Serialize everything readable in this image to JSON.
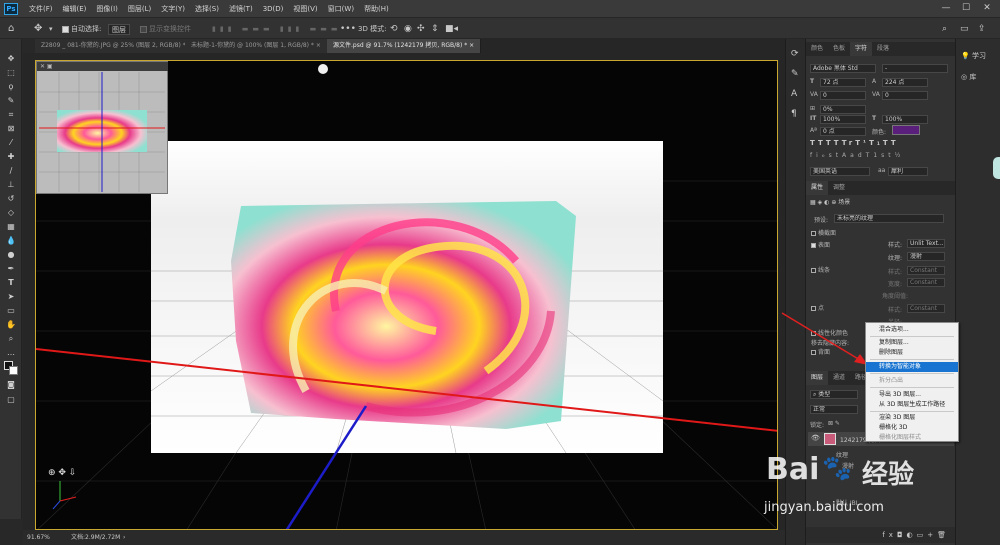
{
  "app": {
    "logo": "Ps"
  },
  "menu": [
    "文件(F)",
    "编辑(E)",
    "图像(I)",
    "图层(L)",
    "文字(Y)",
    "选择(S)",
    "滤镜(T)",
    "3D(D)",
    "视图(V)",
    "窗口(W)",
    "帮助(H)"
  ],
  "options_bar": {
    "auto_select_label": "自动选择:",
    "auto_select_value": "图层",
    "show_transform_label": "显示变换控件",
    "mode_3d_label": "3D 模式:"
  },
  "tabs": [
    "Z2809 _ 081-你黛的.JPG @ 25% (图层 2, RGB/8) *",
    "未标题-1-你黛的 @ 100% (图层 1, RGB/8) *",
    "源文件.psd @ 91.7% (1242179 拷贝, RGB/8) *"
  ],
  "status": {
    "zoom": "91.67%",
    "doc": "文档:2.9M/2.72M"
  },
  "character_panel": {
    "tabs": [
      "颜色",
      "色板",
      "字符",
      "段落"
    ],
    "font": "Adobe 黑体 Std",
    "style": "-",
    "size": "72 点",
    "leading": "224 点",
    "kerning": "0",
    "tracking": "0",
    "scale_pct": "0%",
    "vert_scale": "100%",
    "horiz_scale": "100%",
    "baseline": "0 点",
    "color_label": "颜色:",
    "typo_buttons": [
      "T",
      "T",
      "TT",
      "Tr",
      "T¹",
      "T₁",
      "T",
      "T"
    ],
    "extra_buttons": [
      "fi",
      "ℴ",
      "st",
      "A",
      "ad",
      "T",
      "1st",
      "½"
    ],
    "language": "美国英语",
    "aa_symbol": "aa",
    "antialias": "犀利"
  },
  "properties_panel": {
    "tabs": [
      "属性",
      "调整"
    ],
    "tab_scene": "场景",
    "preset_label": "预设:",
    "preset_value": "未标亮的纹理",
    "cross_section": "横截面",
    "surface": "表面",
    "style_label": "样式:",
    "style_value": "Unlit Text...",
    "texture_label": "纹理:",
    "texture_value": "漫射",
    "lines": "线条",
    "lines_style": "样式:",
    "lines_style_value": "Constant",
    "width_label": "宽度:",
    "width_value": "Constant",
    "angle_label": "角度阈值:",
    "points": "点",
    "points_style": "样式:",
    "points_style_value": "Constant",
    "radius_label": "半径:",
    "linearize": "线性化颜色",
    "remove_hidden": "移去隐藏内容:",
    "backface": "背面"
  },
  "layers_panel": {
    "tabs": [
      "图层",
      "通道",
      "路径"
    ],
    "kind": "类型",
    "blend": "正常",
    "lock_label": "锁定:",
    "layer_name": "1242179 拷贝",
    "texture_label": "纹理",
    "diffuse_label": "漫射",
    "default_ibl": "默认 IBL",
    "bottom_icons": [
      "fx",
      "◘",
      "◐",
      "▭",
      "+",
      "🗑"
    ]
  },
  "context_menu": {
    "items": [
      {
        "label": "混合选项...",
        "state": "normal"
      },
      {
        "label": "复制图层...",
        "state": "normal"
      },
      {
        "label": "删除图层",
        "state": "normal"
      },
      {
        "label": "转换为智能对象",
        "state": "highlighted"
      },
      {
        "label": "拆分凸出",
        "state": "disabled"
      },
      {
        "label": "导出 3D 图层...",
        "state": "normal"
      },
      {
        "label": "从 3D 图层生成工作路径",
        "state": "normal"
      },
      {
        "label": "渲染 3D 图层",
        "state": "normal"
      },
      {
        "label": "栅格化 3D",
        "state": "normal"
      },
      {
        "label": "栅格化图层样式",
        "state": "disabled"
      }
    ]
  },
  "far_right": {
    "learn": "学习",
    "library": "库"
  },
  "watermark": {
    "brand": "Bai",
    "brand2": "经验",
    "url": "jingyan.baidu.com"
  },
  "colors": {
    "accent": "#1874d0",
    "doc_border": "#c8a830",
    "red_axis": "#e01818",
    "blue_axis": "#1c1cc8",
    "arrow": "#e02020",
    "char_color": "#5a1f7a"
  }
}
